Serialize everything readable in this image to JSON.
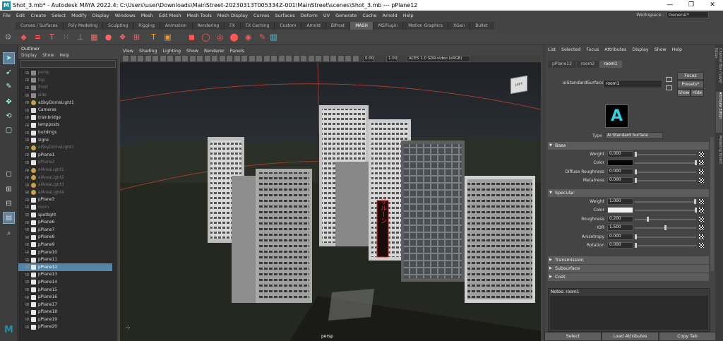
{
  "window": {
    "title": "Shot_3.mb* - Autodesk MAYA 2022.4: C:\\Users\\user\\Downloads\\MainStreet-20230313T005334Z-001\\MainStreet\\scenes\\Shot_3.mb   ---   pPlane12",
    "minimize": "—",
    "maximize": "❐",
    "close": "✕"
  },
  "menubar": {
    "items": [
      "File",
      "Edit",
      "Create",
      "Select",
      "Modify",
      "Display",
      "Windows",
      "Mesh",
      "Edit Mesh",
      "Mesh Tools",
      "Mesh Display",
      "Curves",
      "Surfaces",
      "Deform",
      "UV",
      "Generate",
      "Cache",
      "Arnold",
      "Help"
    ],
    "workspace_label": "Workspace :",
    "workspace_value": "General*"
  },
  "shelf": {
    "tabs": [
      "Curves / Surfaces",
      "Poly Modeling",
      "Sculpting",
      "Rigging",
      "Animation",
      "Rendering",
      "FX",
      "FX Caching",
      "Custom",
      "Arnold",
      "Bifrost",
      "MASH",
      "MSPlugin",
      "Motion Graphics",
      "XGen",
      "Bullet"
    ],
    "active_tab": "MASH"
  },
  "outliner": {
    "title": "Outliner",
    "menu": [
      "Display",
      "Show",
      "Help"
    ],
    "items": [
      {
        "label": "persp",
        "dim": true,
        "icon": "camera"
      },
      {
        "label": "top",
        "dim": true,
        "icon": "camera"
      },
      {
        "label": "front",
        "dim": true,
        "icon": "camera"
      },
      {
        "label": "side",
        "dim": true,
        "icon": "camera"
      },
      {
        "label": "aiSkyDomeLight1",
        "dim": false,
        "icon": "light"
      },
      {
        "label": "Cameras",
        "dim": false,
        "icon": "group"
      },
      {
        "label": "trainbridge",
        "dim": false,
        "icon": "mesh"
      },
      {
        "label": "lampposts",
        "dim": false,
        "icon": "mesh"
      },
      {
        "label": "buildings",
        "dim": false,
        "icon": "mesh"
      },
      {
        "label": "signs",
        "dim": false,
        "icon": "mesh"
      },
      {
        "label": "aiSkyDomeLight2",
        "dim": true,
        "icon": "light"
      },
      {
        "label": "pPlane1",
        "dim": false,
        "icon": "mesh"
      },
      {
        "label": "pPlane2",
        "dim": true,
        "icon": "mesh"
      },
      {
        "label": "aiAreaLight1",
        "dim": true,
        "icon": "light"
      },
      {
        "label": "aiAreaLight2",
        "dim": true,
        "icon": "light"
      },
      {
        "label": "aiAreaLight3",
        "dim": true,
        "icon": "light"
      },
      {
        "label": "aiAreaLight4",
        "dim": true,
        "icon": "light"
      },
      {
        "label": "pPlane3",
        "dim": false,
        "icon": "mesh"
      },
      {
        "label": "room",
        "dim": true,
        "icon": "mesh"
      },
      {
        "label": "spotlight",
        "dim": false,
        "icon": "mesh"
      },
      {
        "label": "pPlane6",
        "dim": false,
        "icon": "mesh"
      },
      {
        "label": "pPlane7",
        "dim": false,
        "icon": "mesh"
      },
      {
        "label": "pPlane8",
        "dim": false,
        "icon": "mesh"
      },
      {
        "label": "pPlane9",
        "dim": false,
        "icon": "mesh"
      },
      {
        "label": "pPlane10",
        "dim": false,
        "icon": "mesh"
      },
      {
        "label": "pPlane11",
        "dim": false,
        "icon": "mesh"
      },
      {
        "label": "pPlane12",
        "dim": false,
        "icon": "mesh",
        "selected": true
      },
      {
        "label": "pPlane13",
        "dim": false,
        "icon": "mesh"
      },
      {
        "label": "pPlane14",
        "dim": false,
        "icon": "mesh"
      },
      {
        "label": "pPlane15",
        "dim": false,
        "icon": "mesh"
      },
      {
        "label": "pPlane16",
        "dim": false,
        "icon": "mesh"
      },
      {
        "label": "pPlane17",
        "dim": false,
        "icon": "mesh"
      },
      {
        "label": "pPlane18",
        "dim": false,
        "icon": "mesh"
      },
      {
        "label": "pPlane19",
        "dim": false,
        "icon": "mesh"
      },
      {
        "label": "pPlane20",
        "dim": false,
        "icon": "mesh"
      }
    ]
  },
  "viewport": {
    "menu": [
      "View",
      "Shading",
      "Lighting",
      "Show",
      "Renderer",
      "Panels"
    ],
    "field_a": "0.00",
    "field_b": "1.00",
    "colorspace": "ACES 1.0 SDR-video (sRGB)",
    "camera_label": "persp",
    "viewcube_label": "LEFT",
    "sign_text": "サルーン"
  },
  "attribute_editor": {
    "menu": [
      "List",
      "Selected",
      "Focus",
      "Attributes",
      "Display",
      "Show",
      "Help"
    ],
    "tabs": [
      "pPlane12",
      "room2",
      "room1"
    ],
    "active_tab": "room1",
    "node_label": "aiStandardSurface:",
    "node_value": "room1",
    "focus_btn": "Focus",
    "presets_btn": "Presets*",
    "show_btn": "Show",
    "hide_btn": "Hide",
    "swatch_letter": "A",
    "type_label": "Type",
    "type_value": "Ai Standard Surface",
    "sections": {
      "base": "Base",
      "specular": "Specular",
      "transmission": "Transmission",
      "subsurface": "Subsurface",
      "coat": "Coat"
    },
    "base_attrs": [
      {
        "label": "Weight",
        "value": "0.000",
        "level": 0.0
      },
      {
        "label": "Color",
        "value": "",
        "color": "#050505"
      },
      {
        "label": "Diffuse Roughness",
        "value": "0.000",
        "level": 0.0
      },
      {
        "label": "Metalness",
        "value": "0.000",
        "level": 0.0
      }
    ],
    "spec_attrs": [
      {
        "label": "Weight",
        "value": "1.000",
        "level": 1.0
      },
      {
        "label": "Color",
        "value": "",
        "color": "#f2f2f2"
      },
      {
        "label": "Roughness",
        "value": "0.200",
        "level": 0.2
      },
      {
        "label": "IOR",
        "value": "1.500",
        "level": 0.5
      },
      {
        "label": "Anisotropy",
        "value": "0.000",
        "level": 0.0
      },
      {
        "label": "Rotation",
        "value": "0.000",
        "level": 0.0
      }
    ],
    "notes_label": "Notes:  room1",
    "bottom_buttons": [
      "Select",
      "Load Attributes",
      "Copy Tab"
    ]
  },
  "side_tabs": [
    "Channel Box / Layer Editor",
    "Attribute Editor",
    "Modeling Toolkit"
  ],
  "colors": {
    "selection": "#5285a6",
    "maya_teal": "#1c8fa8",
    "arnold_cyan": "#2fd2e0"
  }
}
